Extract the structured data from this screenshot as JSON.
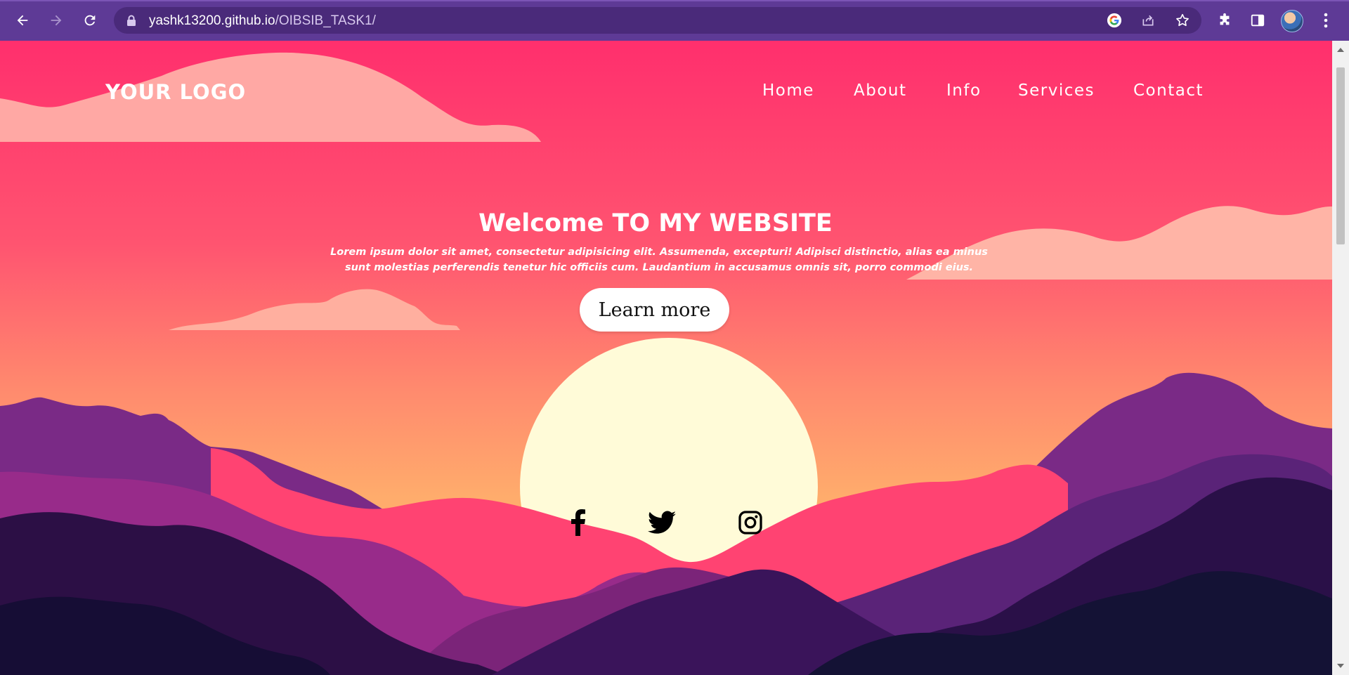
{
  "browser": {
    "url_host": "yashk13200.github.io",
    "url_path": "/OIBSIB_TASK1/",
    "icons": {
      "back": "back-arrow-icon",
      "forward": "forward-arrow-icon",
      "reload": "reload-icon",
      "lock": "lock-icon",
      "google": "google-icon",
      "share": "share-icon",
      "bookmark": "star-icon",
      "extensions": "puzzle-icon",
      "side_panel": "side-panel-icon",
      "menu": "kebab-menu-icon"
    }
  },
  "site": {
    "logo": "YOUR LOGO",
    "nav": [
      {
        "label": "Home"
      },
      {
        "label": "About"
      },
      {
        "label": "Info"
      },
      {
        "label": "Services"
      },
      {
        "label": "Contact"
      }
    ],
    "hero": {
      "title": "Welcome TO MY WEBSITE",
      "text": "Lorem ipsum dolor sit amet, consectetur adipisicing elit. Assumenda, excepturi! Adipisci distinctio, alias ea minus sunt molestias perferendis tenetur hic officiis cum. Laudantium in accusamus omnis sit, porro commodi eius.",
      "button_label": "Learn more"
    },
    "social": [
      "facebook-icon",
      "twitter-icon",
      "instagram-icon"
    ]
  },
  "colors": {
    "browser_frame": "#5e3a96",
    "sky_top": "#ff2f6d",
    "sky_bottom": "#ffa86b",
    "sun": "#fffbd8",
    "cloud": "#ffb0a4"
  }
}
